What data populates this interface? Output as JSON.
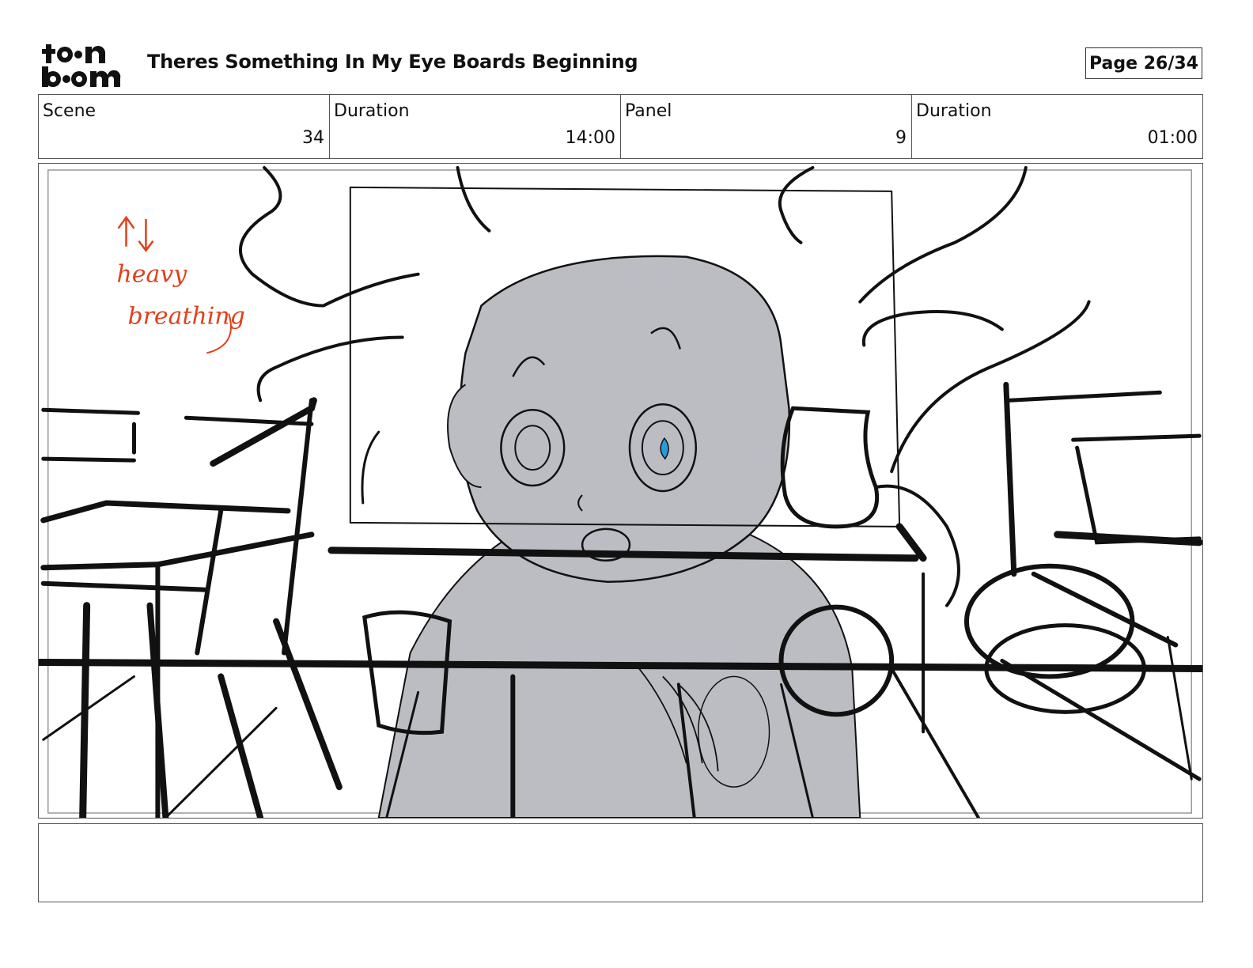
{
  "header": {
    "logo_text": "toon boom",
    "title": "Theres Something In My Eye Boards Beginning",
    "page": "Page 26/34"
  },
  "info": [
    {
      "label": "Scene",
      "value": "34"
    },
    {
      "label": "Duration",
      "value": "14:00"
    },
    {
      "label": "Panel",
      "value": "9"
    },
    {
      "label": "Duration",
      "value": "01:00"
    }
  ],
  "panel": {
    "annotation_line1": "heavy",
    "annotation_line2": "breathing",
    "annotation_color": "#e0401a",
    "eye_color": "#2a9bd8",
    "character_fill": "#bcbdc2"
  },
  "caption": ""
}
